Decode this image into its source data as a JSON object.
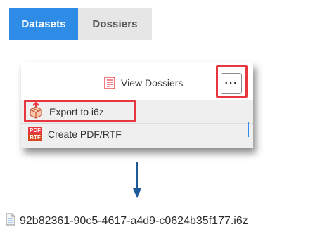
{
  "tabs": [
    {
      "label": "Datasets",
      "active": true
    },
    {
      "label": "Dossiers",
      "active": false
    }
  ],
  "toolbar": {
    "view_dossiers_label": "View Dossiers",
    "view_dossiers_icon": "document-list-icon",
    "more_label": "···",
    "more_icon": "ellipsis-icon"
  },
  "menu": {
    "items": [
      {
        "label": "Export to i6z",
        "icon": "export-package-icon",
        "highlighted": true
      },
      {
        "label": "Create PDF/RTF",
        "icon": "pdf-rtf-icon",
        "badge_top": "PDF",
        "badge_bottom": "RTF"
      }
    ]
  },
  "file": {
    "name": "92b82361-90c5-4617-a4d9-c0624b35f177.i6z",
    "icon": "file-icon"
  },
  "colors": {
    "accent": "#2f8ce6",
    "highlight": "#e8363f",
    "arrow": "#1f5a9a",
    "menu_bg": "#efefef",
    "tab_bg": "#e6e6e6"
  }
}
